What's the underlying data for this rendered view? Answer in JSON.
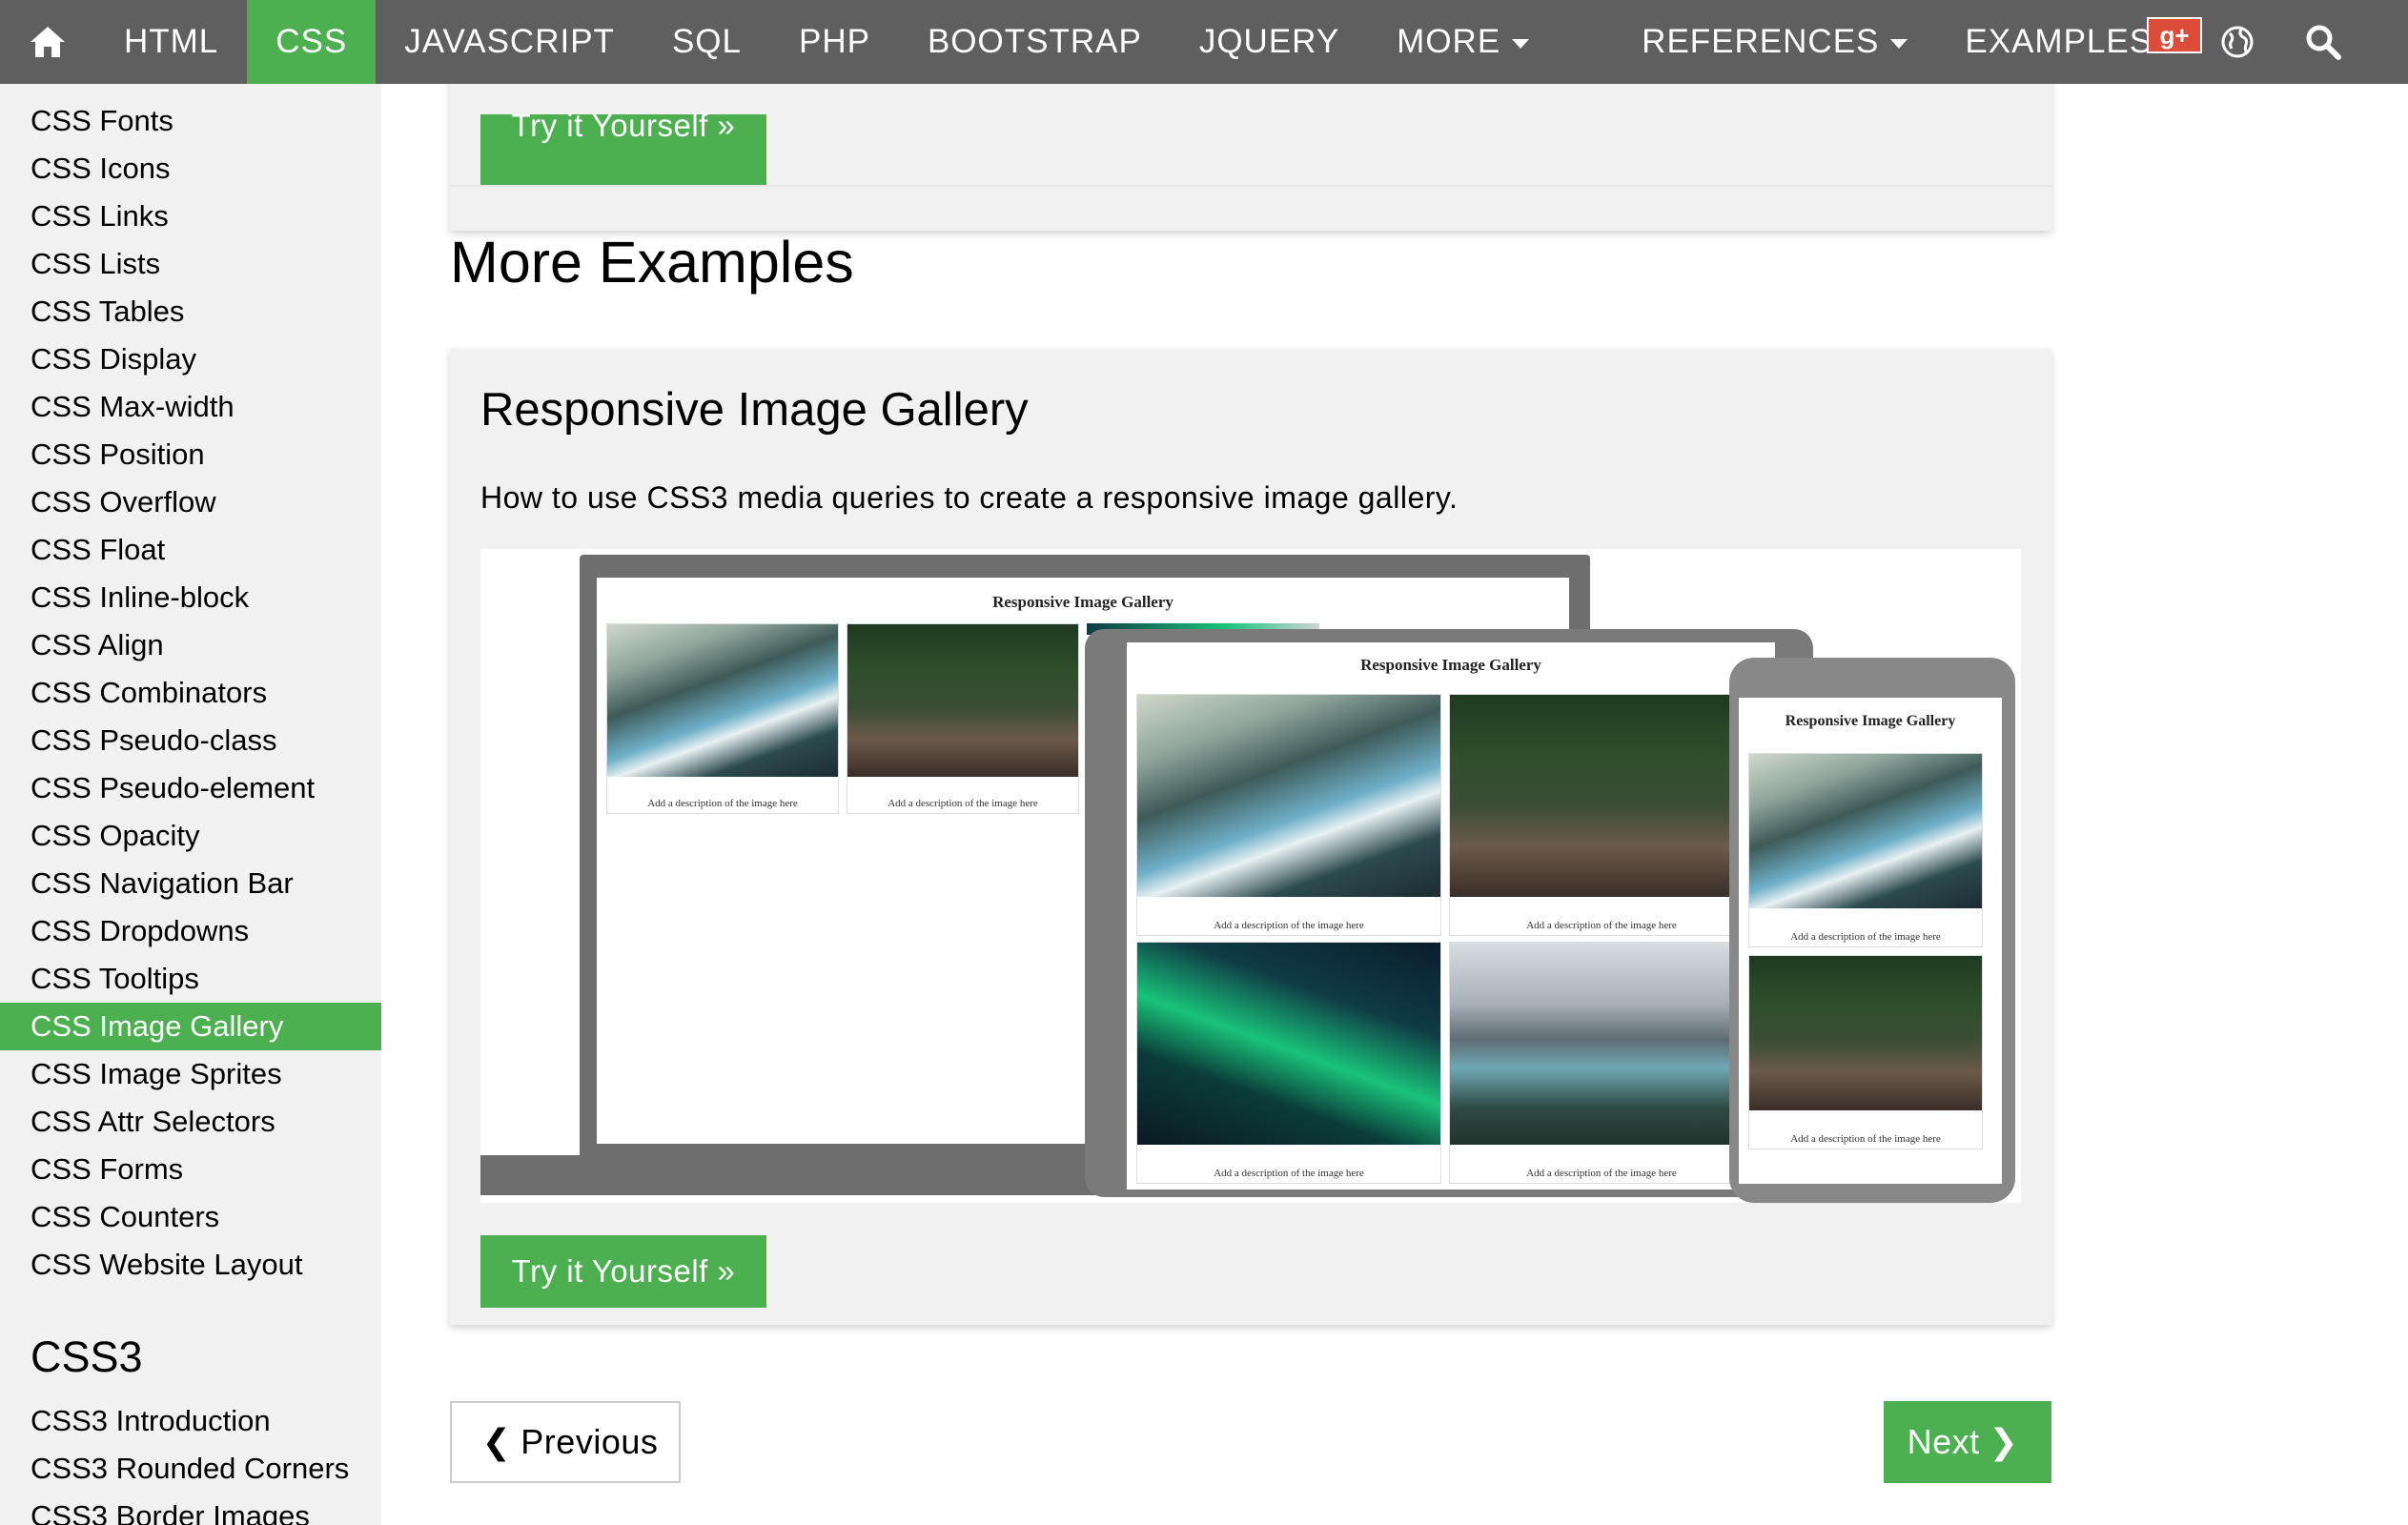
{
  "topnav": {
    "items": [
      {
        "label": "HTML"
      },
      {
        "label": "CSS"
      },
      {
        "label": "JAVASCRIPT"
      },
      {
        "label": "SQL"
      },
      {
        "label": "PHP"
      },
      {
        "label": "BOOTSTRAP"
      },
      {
        "label": "JQUERY"
      },
      {
        "label": "MORE"
      },
      {
        "label": "REFERENCES"
      },
      {
        "label": "EXAMPLES"
      }
    ],
    "active_index": 1,
    "icons": [
      "home-icon",
      "globe-icon",
      "search-icon",
      "google-plus-icon"
    ],
    "colors": {
      "bar": "#5f5f5f",
      "accent": "#4caf50"
    }
  },
  "sidebar": {
    "items": [
      {
        "label": "CSS Fonts"
      },
      {
        "label": "CSS Icons"
      },
      {
        "label": "CSS Links"
      },
      {
        "label": "CSS Lists"
      },
      {
        "label": "CSS Tables"
      },
      {
        "label": "CSS Display"
      },
      {
        "label": "CSS Max-width"
      },
      {
        "label": "CSS Position"
      },
      {
        "label": "CSS Overflow"
      },
      {
        "label": "CSS Float"
      },
      {
        "label": "CSS Inline-block"
      },
      {
        "label": "CSS Align"
      },
      {
        "label": "CSS Combinators"
      },
      {
        "label": "CSS Pseudo-class"
      },
      {
        "label": "CSS Pseudo-element"
      },
      {
        "label": "CSS Opacity"
      },
      {
        "label": "CSS Navigation Bar"
      },
      {
        "label": "CSS Dropdowns"
      },
      {
        "label": "CSS Tooltips"
      },
      {
        "label": "CSS Image Gallery"
      },
      {
        "label": "CSS Image Sprites"
      },
      {
        "label": "CSS Attr Selectors"
      },
      {
        "label": "CSS Forms"
      },
      {
        "label": "CSS Counters"
      },
      {
        "label": "CSS Website Layout"
      }
    ],
    "active_index": 19,
    "css3_heading": "CSS3",
    "css3_items": [
      {
        "label": "CSS3 Introduction"
      },
      {
        "label": "CSS3 Rounded Corners"
      },
      {
        "label": "CSS3 Border Images"
      }
    ]
  },
  "main": {
    "top_button": "Try it Yourself »",
    "section_title": "More Examples",
    "card": {
      "title": "Responsive Image Gallery",
      "description": "How to use CSS3 media queries to create a responsive image gallery.",
      "button": "Try it Yourself »",
      "preview": {
        "gallery_title": "Responsive Image Gallery",
        "caption": "Add a description of the image here"
      }
    },
    "pager": {
      "previous": "Previous",
      "next": "Next"
    }
  }
}
